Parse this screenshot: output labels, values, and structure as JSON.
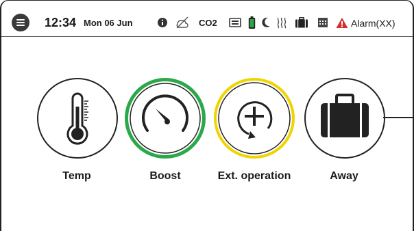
{
  "status": {
    "time": "12:34",
    "date": "Mon 06 Jun",
    "co2": "CO2",
    "alarm": "Alarm(XX)",
    "icons": [
      "menu-icon",
      "info-icon",
      "no-connection-icon",
      "co2-label",
      "display-icon",
      "battery-icon",
      "night-icon",
      "heating-icon",
      "away-icon",
      "calendar-icon",
      "alarm-icon"
    ],
    "colors": {
      "battery": "#2aa84a",
      "alarm": "#d32f2f"
    }
  },
  "tiles": [
    {
      "id": "temp",
      "label": "Temp",
      "icon": "thermometer-icon",
      "ring": "#222222"
    },
    {
      "id": "boost",
      "label": "Boost",
      "icon": "speedometer-icon",
      "ring": "#2aa84a"
    },
    {
      "id": "ext",
      "label": "Ext. operation",
      "icon": "plus-circle-icon",
      "ring": "#f0d400"
    },
    {
      "id": "away",
      "label": "Away",
      "icon": "suitcase-icon",
      "ring": "#222222"
    }
  ]
}
